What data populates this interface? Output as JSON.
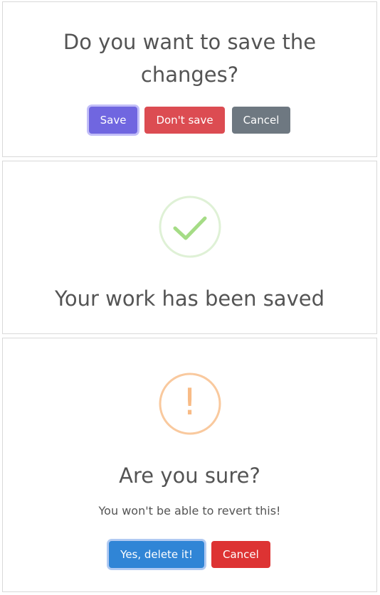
{
  "dialog_save": {
    "title": "Do you want to save the changes?",
    "buttons": {
      "save": "Save",
      "dont_save": "Don't save",
      "cancel": "Cancel"
    },
    "colors": {
      "save": "#7066e0",
      "dont_save": "#dc4c52",
      "cancel": "#6e7881"
    }
  },
  "dialog_saved": {
    "icon": "success-check-icon",
    "title": "Your work has been saved",
    "colors": {
      "icon_ring": "#dff1d6",
      "icon_check": "#a5dc86"
    }
  },
  "dialog_confirm": {
    "icon": "warning-icon",
    "icon_glyph": "!",
    "title": "Are you sure?",
    "text": "You won't be able to revert this!",
    "buttons": {
      "confirm": "Yes, delete it!",
      "cancel": "Cancel"
    },
    "colors": {
      "icon": "#f8bb86",
      "confirm": "#3085d6",
      "cancel": "#dd3333"
    }
  }
}
